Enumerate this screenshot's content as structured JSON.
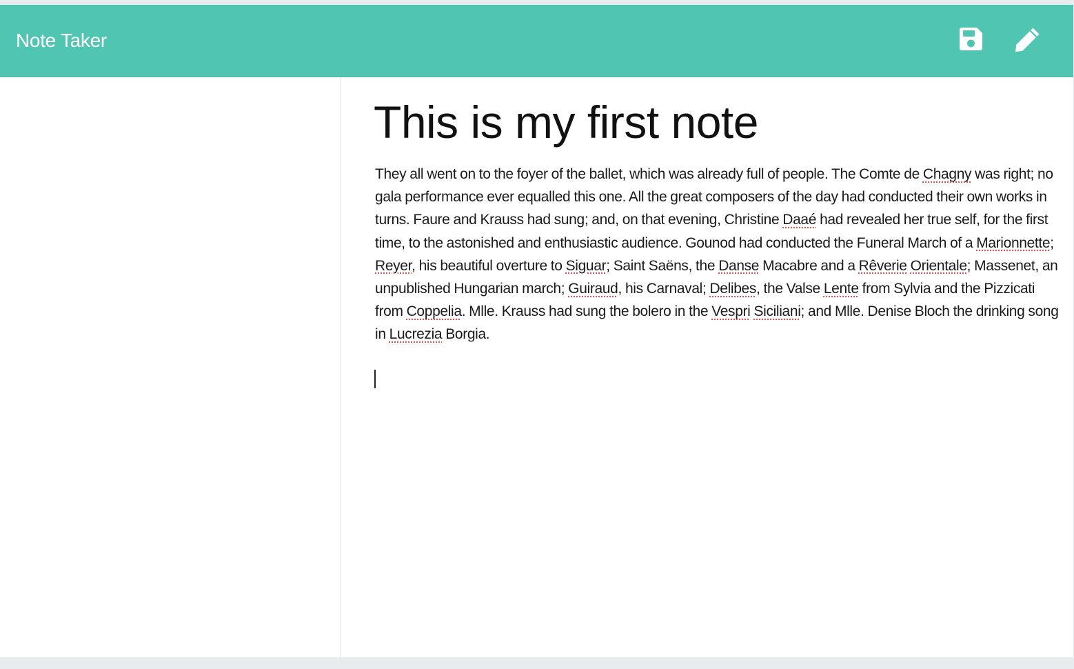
{
  "app": {
    "brand": "Note Taker",
    "accent_color": "#50c5b1"
  },
  "toolbar": {
    "save_icon": "save-icon",
    "edit_icon": "pencil-icon"
  },
  "sidebar": {
    "notes": []
  },
  "note": {
    "title": "This is my first note",
    "body_segments": [
      "They all went on to the foyer of the ballet, which was already full of people. The Comte de ",
      "Chagny",
      " was right; no gala performance ever equalled this one. All the great composers of the day had conducted their own works in turns. Faure and Krauss had sung; and, on that evening, Christine ",
      "Daaé",
      " had revealed her true self, for the first time, to the astonished and enthusiastic audience. Gounod had conducted the Funeral March of a ",
      "Marionnette",
      "; ",
      "Reyer",
      ", his beautiful overture to ",
      "Siguar",
      "; Saint Saëns, the ",
      "Danse",
      " Macabre and a ",
      "Rêverie",
      " ",
      "Orientale",
      "; Massenet, an unpublished Hungarian march; ",
      "Guiraud",
      ", his Carnaval; ",
      "Delibes",
      ", the Valse ",
      "Lente",
      " from Sylvia and the Pizzicati from ",
      "Coppelia",
      ". Mlle. Krauss had sung the bolero in the ",
      "Vespri",
      " ",
      "Siciliani",
      "; and Mlle. Denise Bloch the drinking song in ",
      "Lucrezia",
      " Borgia."
    ]
  }
}
